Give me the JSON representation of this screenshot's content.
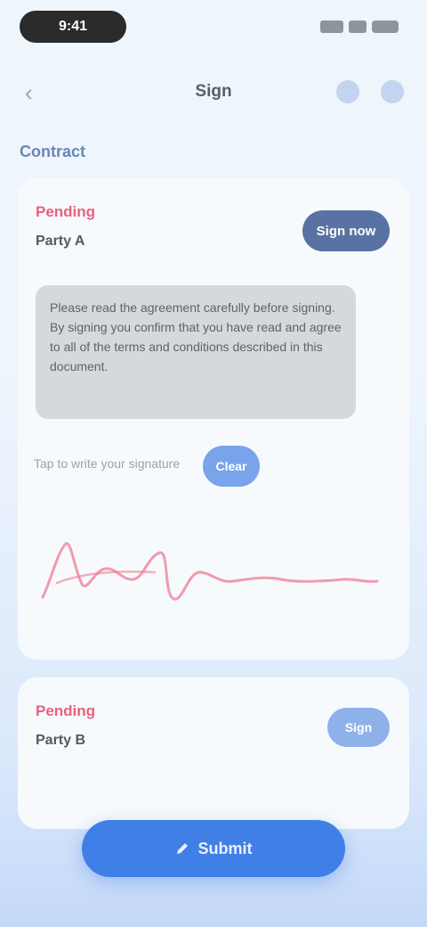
{
  "status_bar": {
    "time": "9:41"
  },
  "nav": {
    "back_glyph": "‹",
    "title": "Sign",
    "icons": [
      "share-icon",
      "more-icon"
    ]
  },
  "section": {
    "label": "Contract"
  },
  "card_main": {
    "badge": "Pending",
    "subtitle": "Party A",
    "action_label": "Sign now",
    "body_text": "Please read the agreement carefully before signing. By signing you confirm that you have read and agree to all of the terms and conditions described in this document.",
    "hint": "Tap to write your signature",
    "hint_button": "Clear"
  },
  "card_second": {
    "badge": "Pending",
    "subtitle": "Party B",
    "action_label": "Sign"
  },
  "primary_button": {
    "label": "Submit"
  },
  "colors": {
    "accent": "#3f7fe6",
    "badge": "#e8607d",
    "dark_button": "#5872a3",
    "signature_ink": "#f07a94"
  }
}
